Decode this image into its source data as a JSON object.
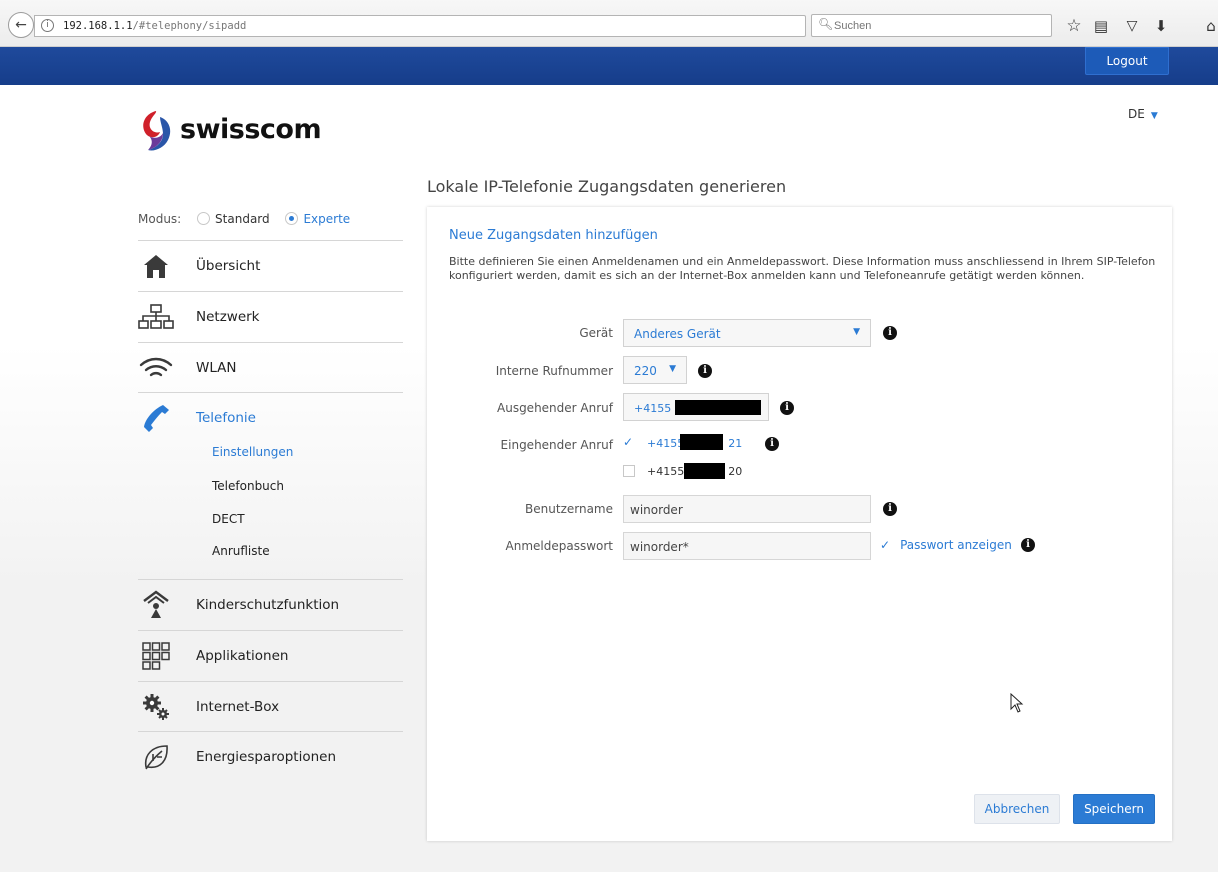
{
  "browser": {
    "url_host": "192.168.1.1",
    "url_path": "/#telephony/sipadd",
    "search_placeholder": "Suchen",
    "icons": [
      "back-arrow-icon",
      "info-icon",
      "reload-icon",
      "search-icon",
      "bookmark-star-icon",
      "reading-list-icon",
      "pocket-icon",
      "download-icon",
      "home-icon"
    ]
  },
  "header": {
    "logout_label": "Logout",
    "logo_text": "swisscom",
    "language": "DE"
  },
  "sidebar": {
    "modus_label": "Modus:",
    "mode_standard": "Standard",
    "mode_expert": "Experte",
    "selected_mode": "Experte",
    "items": [
      {
        "label": "Übersicht",
        "icon": "house-icon"
      },
      {
        "label": "Netzwerk",
        "icon": "network-icon"
      },
      {
        "label": "WLAN",
        "icon": "wifi-icon"
      },
      {
        "label": "Telefonie",
        "icon": "phone-icon",
        "active": true
      },
      {
        "label": "Kinderschutzfunktion",
        "icon": "child-protection-icon"
      },
      {
        "label": "Applikationen",
        "icon": "apps-icon"
      },
      {
        "label": "Internet-Box",
        "icon": "gears-icon"
      },
      {
        "label": "Energiesparoptionen",
        "icon": "leaf-icon"
      }
    ],
    "telefonie_sub": [
      {
        "label": "Einstellungen",
        "active": true
      },
      {
        "label": "Telefonbuch"
      },
      {
        "label": "DECT"
      },
      {
        "label": "Anrufliste"
      }
    ]
  },
  "main": {
    "page_title": "Lokale IP-Telefonie Zugangsdaten generieren",
    "section_title": "Neue Zugangsdaten hinzufügen",
    "description": "Bitte definieren Sie einen Anmeldenamen und ein Anmeldepasswort. Diese Information muss anschliessend in Ihrem SIP-Telefon konfiguriert werden, damit es sich an der Internet-Box anmelden kann und Telefoneanrufe getätigt werden können.",
    "form": {
      "device_label": "Gerät",
      "device_value": "Anderes Gerät",
      "internal_label": "Interne Rufnummer",
      "internal_value": "220",
      "outgoing_label": "Ausgehender Anruf",
      "outgoing_value": "+4155",
      "incoming_label": "Eingehender Anruf",
      "incoming": [
        {
          "prefix": "+4155",
          "suffix": "21",
          "checked": true
        },
        {
          "prefix": "+4155",
          "suffix": "20",
          "checked": false
        }
      ],
      "username_label": "Benutzername",
      "username_value": "winorder",
      "password_label": "Anmeldepasswort",
      "password_value": "winorder*",
      "show_password_label": "Passwort anzeigen",
      "show_password_checked": true
    },
    "cancel_label": "Abbrechen",
    "save_label": "Speichern"
  },
  "colors": {
    "brand_blue": "#163d8a",
    "accent": "#2b7bd4"
  }
}
